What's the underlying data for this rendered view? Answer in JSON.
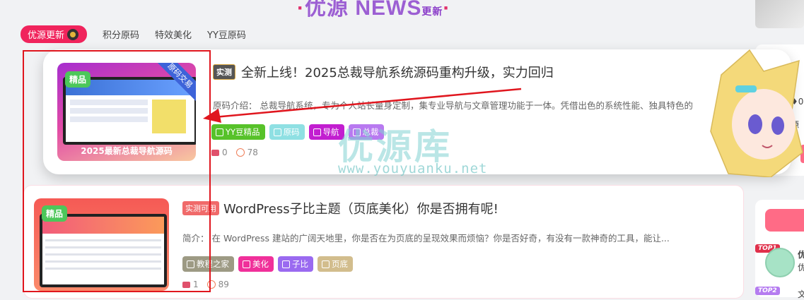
{
  "header": {
    "title_main": "优源 NEWS",
    "title_sub": "更新",
    "title_decor": "·"
  },
  "tabs": [
    {
      "label": "优源更新"
    },
    {
      "label": "积分原码"
    },
    {
      "label": "特效美化"
    },
    {
      "label": "YY豆原码"
    }
  ],
  "posts": [
    {
      "title": "全新上线！2025总裁导航系统源码重构升级，实力回归",
      "label": "实测",
      "badge": "精品",
      "ribbon": "原码交易",
      "thumb_caption": "2025最新总裁导航源码",
      "description": "原码介绍：  总裁导航系统，专为个人站长量身定制，集专业导航与文章管理功能于一体。凭借出色的系统性能、独具特色的",
      "tags": [
        {
          "label": "YY豆精品",
          "color": "#57c22a"
        },
        {
          "label": "原码",
          "color": "#8fe0e3"
        },
        {
          "label": "导航",
          "color": "#c21ed0"
        },
        {
          "label": "总裁",
          "color": "#b879f0"
        }
      ],
      "comments": "0",
      "views": "78"
    },
    {
      "title": "WordPress子比主题（页底美化）你是否拥有呢!",
      "label": "实测可用",
      "badge": "精品",
      "description": "简介：  在 WordPress 建站的广阔天地里，你是否在为页底的呈现效果而烦恼？你是否好奇，有没有一款神奇的工具，能让...",
      "tags": [
        {
          "label": "教程之家",
          "color": "#9d9a84"
        },
        {
          "label": "美化",
          "color": "#f0309a"
        },
        {
          "label": "子比",
          "color": "#9a6af0"
        },
        {
          "label": "页底",
          "color": "#d2bd8d"
        }
      ],
      "comments": "1",
      "views": "89"
    }
  ],
  "watermark": {
    "text": "优源库",
    "url": "www.youyuanku.net"
  },
  "sidebar": {
    "snippet_count": "0",
    "snippet_text": "源",
    "top1": "TOP1",
    "top2": "TOP2",
    "item1_a": "优",
    "item1_b": "优",
    "item2": "文"
  },
  "colors": {
    "accent": "#f0245c",
    "annotation": "#e0161e"
  }
}
